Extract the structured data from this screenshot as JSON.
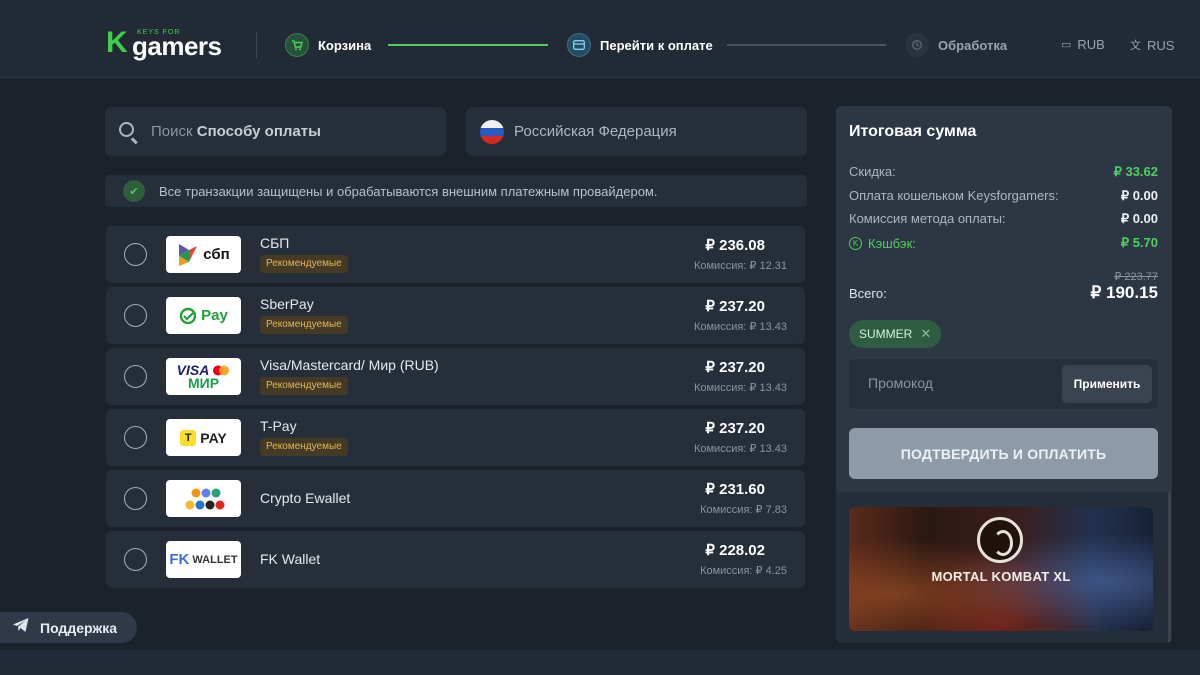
{
  "header": {
    "logo_small": "KEYS FOR",
    "logo_main": "gamers",
    "steps": [
      {
        "label": "Корзина",
        "state": "done"
      },
      {
        "label": "Перейти к оплате",
        "state": "active"
      },
      {
        "label": "Обработка",
        "state": "pending"
      }
    ],
    "currency": "RUB",
    "language": "RUS"
  },
  "search": {
    "placeholder_plain": "Поиск ",
    "placeholder_bold": "Способу оплаты"
  },
  "country": {
    "label": "Российская Федерация"
  },
  "notice": "Все транзакции защищены и обрабатываются внешним платежным провайдером.",
  "payment_methods": [
    {
      "name": "СБП",
      "badge": "Рекомендуемые",
      "price": "₽ 236.08",
      "fee": "Комиссия: ₽ 12.31",
      "logo": "sbp-logo",
      "logo_text": "сбп"
    },
    {
      "name": "SberPay",
      "badge": "Рекомендуемые",
      "price": "₽ 237.20",
      "fee": "Комиссия: ₽ 13.43",
      "logo": "sberpay-logo",
      "logo_text": "Pay"
    },
    {
      "name": "Visa/Mastercard/ Мир (RUB)",
      "badge": "Рекомендуемые",
      "price": "₽ 237.20",
      "fee": "Комиссия: ₽ 13.43",
      "logo": "visa-mastercard-mir-logo",
      "logo_text_1": "VISA",
      "logo_text_2": "МИР"
    },
    {
      "name": "T-Pay",
      "badge": "Рекомендуемые",
      "price": "₽ 237.20",
      "fee": "Комиссия: ₽ 13.43",
      "logo": "tpay-logo",
      "logo_text": "PAY"
    },
    {
      "name": "Crypto Ewallet",
      "badge": "",
      "price": "₽ 231.60",
      "fee": "Комиссия: ₽ 7.83",
      "logo": "crypto-logo"
    },
    {
      "name": "FK Wallet",
      "badge": "",
      "price": "₽ 228.02",
      "fee": "Комиссия: ₽ 4.25",
      "logo": "fkwallet-logo",
      "logo_text": "WALLET"
    }
  ],
  "support": {
    "label": "Поддержка"
  },
  "summary": {
    "title": "Итоговая сумма",
    "discount_label": "Скидка:",
    "discount_value": "₽ 33.62",
    "wallet_label": "Оплата кошельком Keysforgamers:",
    "wallet_value": "₽ 0.00",
    "commission_label": "Комиссия метода оплаты:",
    "commission_value": "₽ 0.00",
    "cashback_label": "Кэшбэк:",
    "cashback_value": "₽ 5.70",
    "old_total": "₽ 223.77",
    "total_label": "Всего:",
    "total_value": "₽ 190.15",
    "promo_chip": "SUMMER",
    "promo_placeholder": "Промокод",
    "apply_label": "Применить",
    "confirm_label": "ПОДТВЕРДИТЬ И ОПЛАТИТЬ",
    "game_title": "MORTAL KOMBAT XL"
  },
  "colors": {
    "accent_green": "#4ecf62",
    "background": "#1b222c",
    "panel": "#2d3643",
    "badge_text": "#e3b657"
  }
}
